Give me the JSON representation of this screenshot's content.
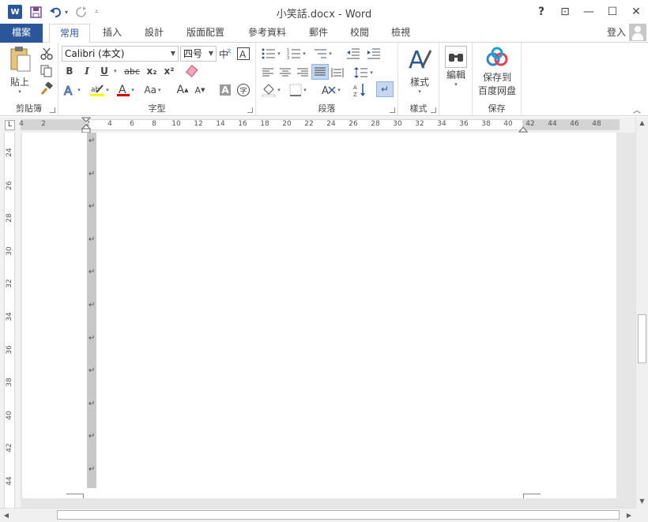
{
  "titlebar": {
    "app_icon": "word-icon",
    "app_icon_text": "W",
    "title": "小笑話.docx - Word",
    "help": "?",
    "ribbon_display": "⊡",
    "minimize": "—",
    "maximize": "☐",
    "close": "✕"
  },
  "tabs": {
    "file": "檔案",
    "home": "常用",
    "insert": "插入",
    "design": "設計",
    "layout": "版面配置",
    "references": "參考資料",
    "mailings": "郵件",
    "review": "校閱",
    "view": "檢視",
    "signin": "登入"
  },
  "ribbon": {
    "clipboard": {
      "paste": "貼上",
      "label": "剪貼簿"
    },
    "font": {
      "font_name": "Calibri (本文)",
      "font_size": "四号",
      "bold": "B",
      "italic": "I",
      "underline": "U",
      "strike": "abc",
      "subscript": "x₂",
      "superscript": "x²",
      "grow": "A",
      "shrink": "A",
      "case": "Aa",
      "shade_a": "A",
      "enclose": "字",
      "label": "字型"
    },
    "paragraph": {
      "label": "段落"
    },
    "styles": {
      "styles": "樣式",
      "label": "樣式"
    },
    "editing": {
      "editing": "編輯"
    },
    "save": {
      "save_line1": "保存到",
      "save_line2": "百度网盘",
      "label": "保存"
    }
  },
  "ruler": {
    "tab_selector": "L",
    "h_ticks": [
      "4",
      "2",
      "2",
      "4",
      "6",
      "8",
      "10",
      "12",
      "14",
      "16",
      "18",
      "20",
      "22",
      "24",
      "26",
      "28",
      "30",
      "32",
      "34",
      "36",
      "38",
      "40",
      "42",
      "44",
      "46",
      "48"
    ],
    "v_ticks": [
      "24",
      "26",
      "28",
      "30",
      "32",
      "34",
      "36",
      "38",
      "40",
      "42",
      "44"
    ]
  },
  "document": {
    "paragraph_mark": "↵"
  },
  "colors": {
    "accent": "#2b579a",
    "font_color_underline": "#e00000",
    "highlight_underline": "#ffff00"
  }
}
